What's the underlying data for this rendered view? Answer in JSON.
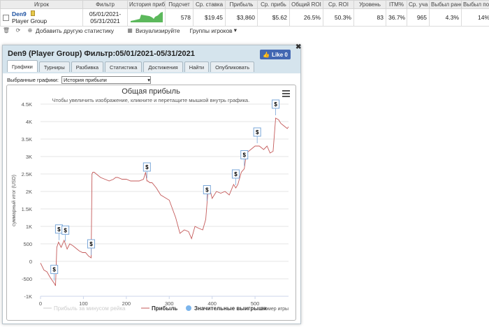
{
  "table": {
    "headers": [
      "Игрок",
      "Фильтр",
      "История приб",
      "Подсчет",
      "Ср. ставка",
      "Прибыль",
      "Ср. прибь",
      "Общий ROI",
      "Ср. ROI",
      "Уровень",
      "ITM%",
      "Ср. уча",
      "Выбыл рано",
      "Выбыл позд"
    ],
    "row": {
      "player_name": "Den9",
      "player_group": "Player Group",
      "filter_from": "05/01/2021-",
      "filter_to": "05/31/2021",
      "count": "578",
      "avg_stake": "$19.45",
      "profit": "$3,860",
      "avg_profit": "$5.62",
      "total_roi": "26.5%",
      "avg_roi": "50.3%",
      "level": "83",
      "itm": "36.7%",
      "avg_entrants": "965",
      "early_out": "4.3%",
      "late_out": "14%"
    }
  },
  "toolbar": {
    "add_stat": "Добавить другую статистику",
    "visualize": "Визуализируйте",
    "groups": "Группы игроков"
  },
  "panel": {
    "title": "Den9 (Player Group) Фильтр:05/01/2021-05/31/2021",
    "like_label": "Like 0",
    "tabs": [
      "Графики",
      "Турниры",
      "Разбивка",
      "Статистика",
      "Достижения",
      "Найти",
      "Опубликовать"
    ],
    "select_label": "Выбранные графики:",
    "select_value": "История прибыли"
  },
  "chart_data": {
    "type": "line",
    "title": "Общая прибыль",
    "subtitle": "Чтобы увеличить изображение, кликните и перетащите мышкой внутрь графика.",
    "ylabel": "суммарный итог (USD)",
    "xlabel": "Номер игры",
    "ylim": [
      -1000,
      4500
    ],
    "xlim": [
      0,
      578
    ],
    "y_ticks": [
      "-1K",
      "-500",
      "0",
      "500",
      "1K",
      "1.5K",
      "2K",
      "2.5K",
      "3K",
      "3.5K",
      "4K",
      "4.5K"
    ],
    "x_ticks": [
      "0",
      "100",
      "200",
      "300",
      "400",
      "500"
    ],
    "legend": [
      "Прибыль за минусом рейка",
      "Прибыль",
      "Значительные выигрыши"
    ],
    "series": [
      {
        "name": "Прибыль",
        "x": [
          0,
          8,
          15,
          22,
          28,
          33,
          35,
          38,
          42,
          48,
          55,
          62,
          68,
          75,
          82,
          90,
          98,
          105,
          112,
          118,
          120,
          122,
          125,
          130,
          140,
          150,
          160,
          170,
          175,
          180,
          190,
          200,
          210,
          220,
          230,
          240,
          245,
          248,
          250,
          255,
          260,
          270,
          280,
          300,
          315,
          325,
          335,
          345,
          352,
          360,
          368,
          378,
          385,
          390,
          395,
          400,
          410,
          420,
          430,
          440,
          450,
          455,
          460,
          468,
          475,
          480,
          490,
          500,
          510,
          520,
          528,
          535,
          542,
          548,
          555,
          560,
          565,
          570,
          575,
          578
        ],
        "y": [
          -50,
          -250,
          -300,
          -450,
          -560,
          -650,
          -700,
          400,
          550,
          400,
          600,
          350,
          500,
          450,
          380,
          300,
          250,
          250,
          150,
          100,
          2500,
          2550,
          2550,
          2500,
          2400,
          2350,
          2300,
          2350,
          2400,
          2400,
          2350,
          2350,
          2300,
          2300,
          2300,
          2350,
          2550,
          2300,
          2300,
          2250,
          2250,
          2100,
          1900,
          1750,
          1250,
          800,
          900,
          850,
          650,
          1000,
          950,
          900,
          1200,
          1950,
          2050,
          1800,
          2000,
          1950,
          2000,
          1900,
          2200,
          2100,
          2200,
          2550,
          2650,
          3100,
          3200,
          3300,
          3300,
          3200,
          3300,
          3100,
          3150,
          4100,
          4050,
          3950,
          3900,
          3850,
          3800,
          3850
        ]
      }
    ],
    "big_wins_x": [
      32,
      43,
      58,
      118,
      248,
      388,
      455,
      475,
      505,
      548
    ]
  }
}
